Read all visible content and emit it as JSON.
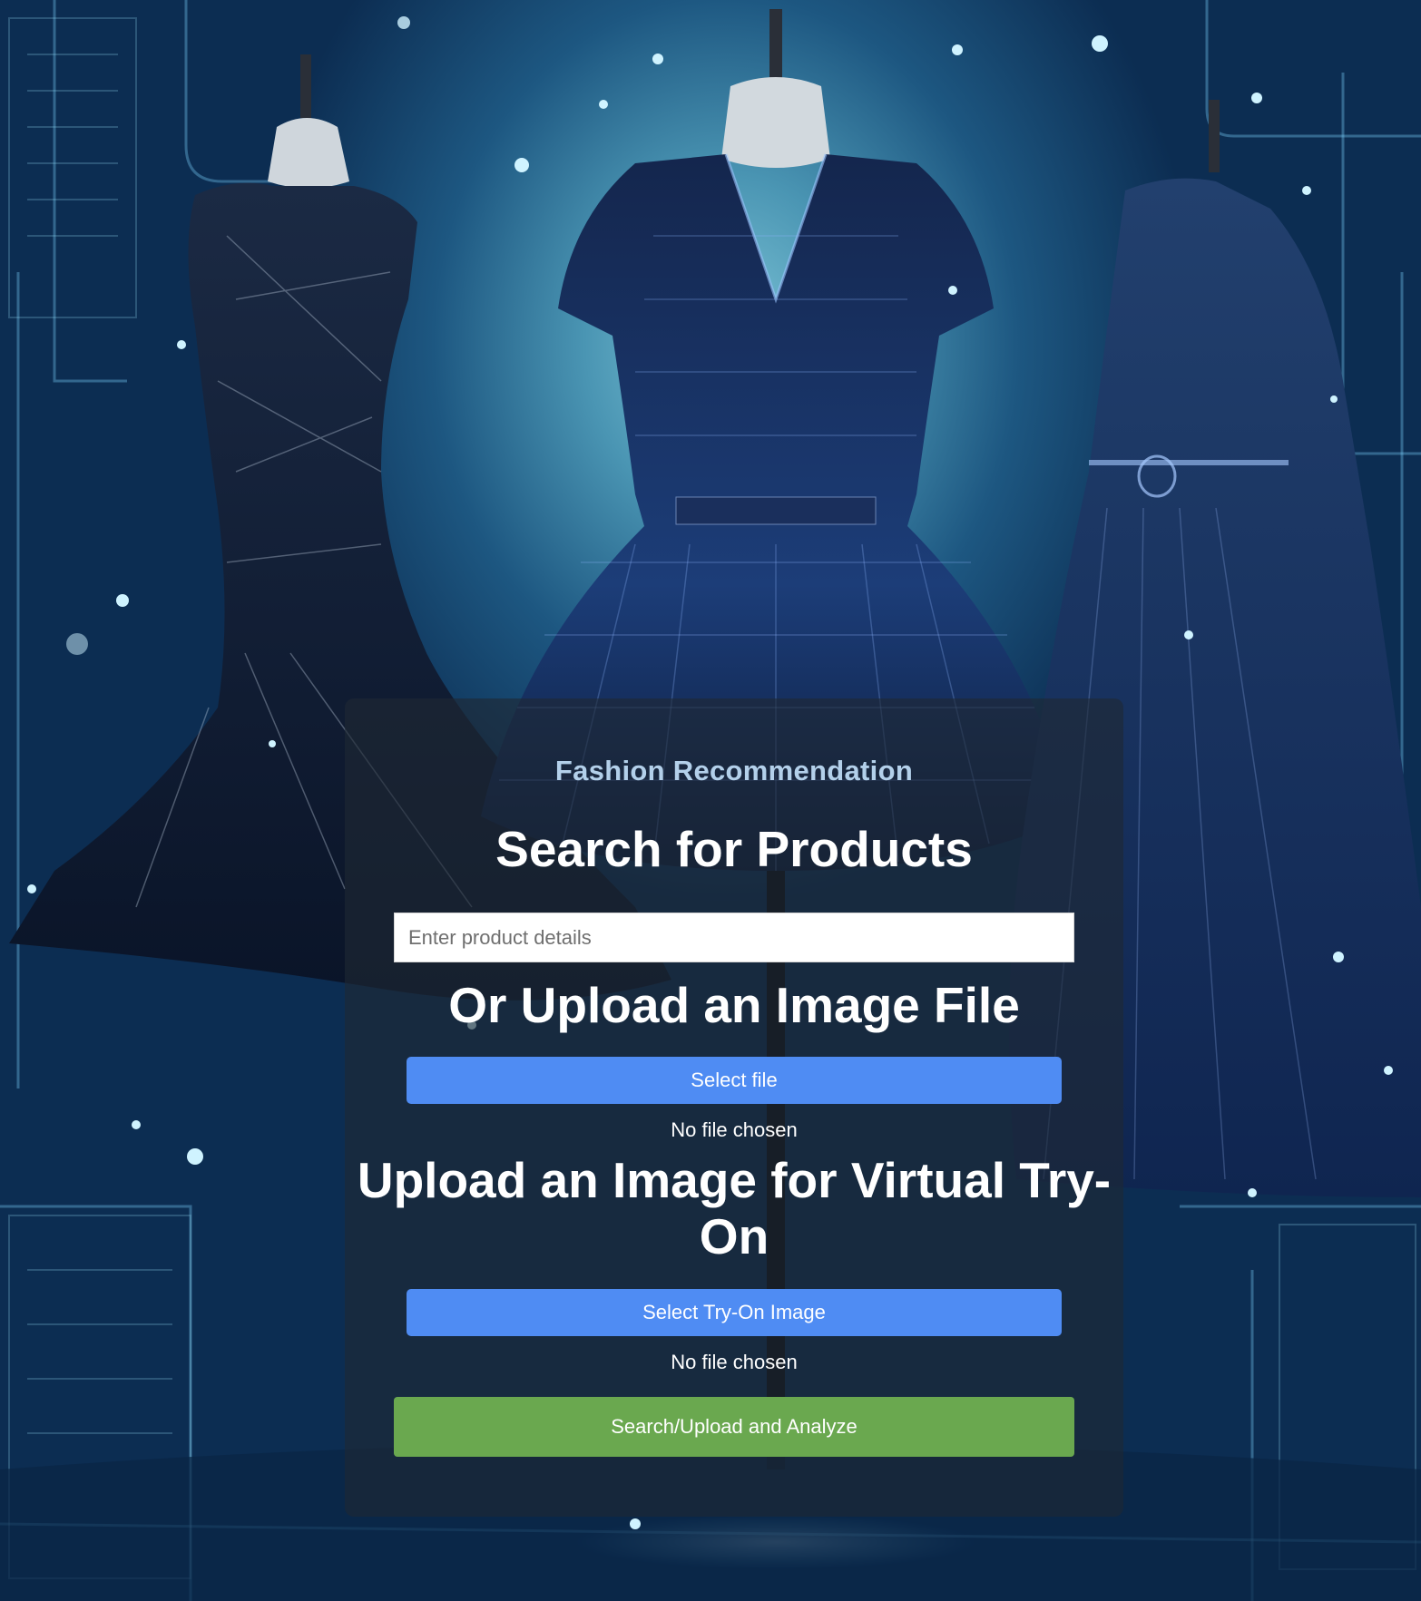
{
  "app": {
    "brand_title": "Fashion Recommendation"
  },
  "search": {
    "heading": "Search for Products",
    "placeholder": "Enter product details",
    "value": ""
  },
  "image_upload": {
    "heading": "Or Upload an Image File",
    "button_label": "Select file",
    "status": "No file chosen"
  },
  "tryon_upload": {
    "heading": "Upload an Image for Virtual Try-On",
    "button_label": "Select Try-On Image",
    "status": "No file chosen"
  },
  "actions": {
    "submit_label": "Search/Upload and Analyze"
  },
  "background": {
    "description_icon": "dress-mannequin-illustration",
    "colors": {
      "sky": "#4a95b3",
      "deep": "#0c2d52",
      "dress": "#0f1f3d",
      "glow": "#8fe3ff"
    }
  },
  "theme": {
    "primary_button": "#4f8cf3",
    "submit_button": "#6aa84f",
    "brand_text": "#b3d0ea",
    "card_bg": "rgba(30,40,52,0.62)"
  }
}
